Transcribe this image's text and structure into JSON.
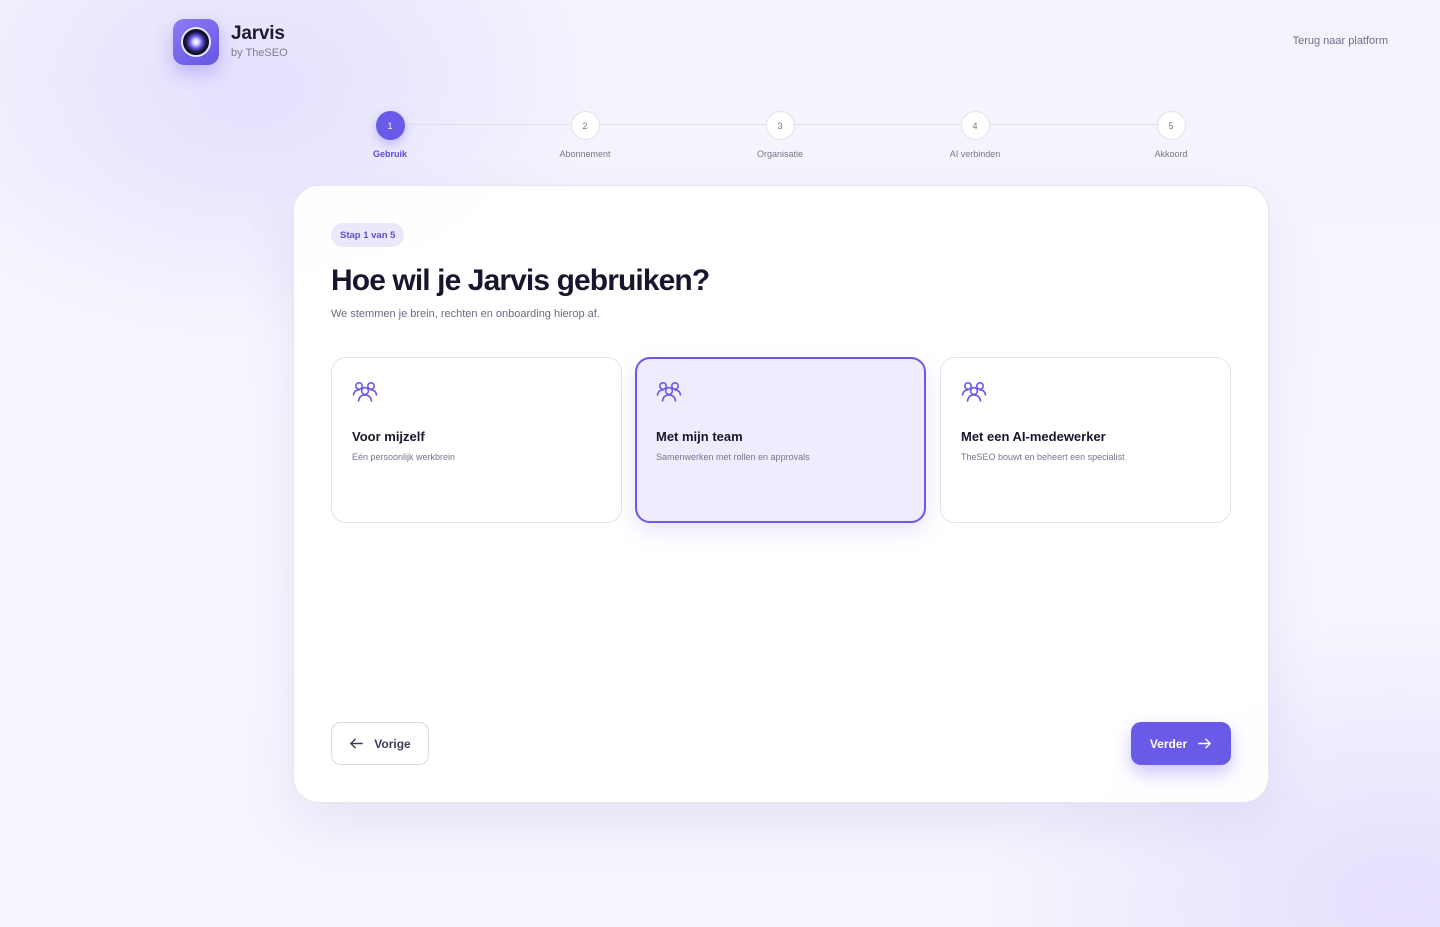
{
  "brand": {
    "name": "Jarvis",
    "subtitle": "by TheSEO",
    "logo_icon": "jarvis-orb-icon",
    "accent_color": "#6a5ae8"
  },
  "header": {
    "back_link": "Terug naar platform"
  },
  "stepper": {
    "current_step": 1,
    "steps": [
      {
        "number": "1",
        "label": "Gebruik"
      },
      {
        "number": "2",
        "label": "Abonnement"
      },
      {
        "number": "3",
        "label": "Organisatie"
      },
      {
        "number": "4",
        "label": "AI verbinden"
      },
      {
        "number": "5",
        "label": "Akkoord"
      }
    ]
  },
  "card": {
    "badge": "Stap 1 van 5",
    "title": "Hoe wil je Jarvis gebruiken?",
    "subtitle": "We stemmen je brein, rechten en onboarding hierop af.",
    "options": [
      {
        "title": "Voor mijzelf",
        "description": "Eén persoonlijk werkbrein",
        "icon": "users-icon",
        "selected": false
      },
      {
        "title": "Met mijn team",
        "description": "Samenwerken met rollen en approvals",
        "icon": "users-icon",
        "selected": true
      },
      {
        "title": "Met een AI-medewerker",
        "description": "TheSEO bouwt en beheert een specialist",
        "icon": "users-icon",
        "selected": false
      }
    ],
    "prev_button": "Vorige",
    "next_button": "Verder"
  }
}
